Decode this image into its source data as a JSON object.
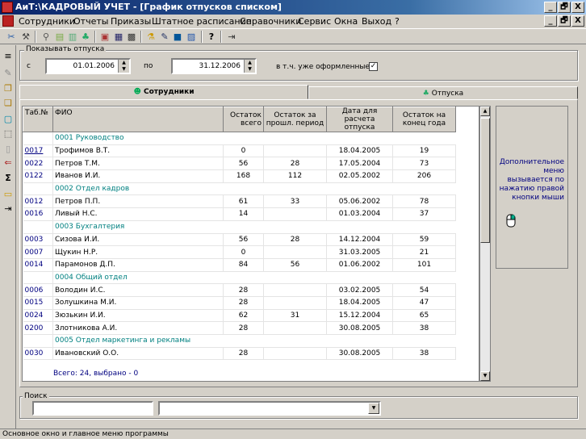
{
  "window": {
    "title": "АиТ:\\КАДРОВЫЙ УЧЕТ - [График отпусков списком]",
    "minimize": "_",
    "maximize": "🗗",
    "close": "X"
  },
  "menu": [
    "Сотрудники",
    "Отчеты",
    "Приказы",
    "Штатное расписание",
    "Справочники",
    "Сервис",
    "Окна",
    "Выход",
    "?"
  ],
  "filter": {
    "group_label": "Показывать отпуска",
    "from_label": "с",
    "from_value": "01.01.2006",
    "to_label": "по",
    "to_value": "31.12.2006",
    "checkbox_label": "в т.ч. уже оформленные",
    "checkbox_checked": "✓"
  },
  "tabs": [
    {
      "label": "Сотрудники",
      "icon": "people-icon"
    },
    {
      "label": "Отпуска",
      "icon": "palm-icon"
    }
  ],
  "table": {
    "headers": [
      "Таб.№",
      "ФИО",
      "Остаток всего",
      "Остаток за прошл. период",
      "Дата для расчета отпуска",
      "Остаток на конец года"
    ],
    "rows": [
      {
        "group": "0001 Руководство"
      },
      {
        "tab": "0017",
        "fio": "Трофимов В.Т.",
        "total": "0",
        "prev": "",
        "date": "18.04.2005",
        "end": "19"
      },
      {
        "tab": "0022",
        "fio": "Петров Т.М.",
        "total": "56",
        "prev": "28",
        "date": "17.05.2004",
        "end": "73"
      },
      {
        "tab": "0122",
        "fio": "Иванов И.И.",
        "total": "168",
        "prev": "112",
        "date": "02.05.2002",
        "end": "206"
      },
      {
        "group": "0002 Отдел кадров"
      },
      {
        "tab": "0012",
        "fio": "Петров П.П.",
        "total": "61",
        "prev": "33",
        "date": "05.06.2002",
        "end": "78"
      },
      {
        "tab": "0016",
        "fio": "Ливый Н.С.",
        "total": "14",
        "prev": "",
        "date": "01.03.2004",
        "end": "37"
      },
      {
        "group": "0003 Бухгалтерия"
      },
      {
        "tab": "0003",
        "fio": "Сизова И.И.",
        "total": "56",
        "prev": "28",
        "date": "14.12.2004",
        "end": "59"
      },
      {
        "tab": "0007",
        "fio": "Щукин Н.Р.",
        "total": "0",
        "prev": "",
        "date": "31.03.2005",
        "end": "21"
      },
      {
        "tab": "0014",
        "fio": "Парамонов Д.П.",
        "total": "84",
        "prev": "56",
        "date": "01.06.2002",
        "end": "101"
      },
      {
        "group": "0004 Общий отдел"
      },
      {
        "tab": "0006",
        "fio": "Володин И.С.",
        "total": "28",
        "prev": "",
        "date": "03.02.2005",
        "end": "54"
      },
      {
        "tab": "0015",
        "fio": "Золушкина М.И.",
        "total": "28",
        "prev": "",
        "date": "18.04.2005",
        "end": "47"
      },
      {
        "tab": "0024",
        "fio": "Зюзькин И.И.",
        "total": "62",
        "prev": "31",
        "date": "15.12.2004",
        "end": "65"
      },
      {
        "tab": "0200",
        "fio": "Злотникова А.И.",
        "total": "28",
        "prev": "",
        "date": "30.08.2005",
        "end": "38"
      },
      {
        "group": "0005 Отдел маркетинга и рекламы"
      },
      {
        "tab": "0030",
        "fio": "Ивановский О.О.",
        "total": "28",
        "prev": "",
        "date": "30.08.2005",
        "end": "38"
      }
    ],
    "footer": "Всего: 24, выбрано - 0"
  },
  "info_panel": {
    "text": "Дополнительное меню вызывается по нажатию правой кнопки мыши",
    "icon": "mouse-icon"
  },
  "search": {
    "group_label": "Поиск",
    "input_value": "",
    "combo_value": ""
  },
  "status": "Основное окно и главное меню программы"
}
